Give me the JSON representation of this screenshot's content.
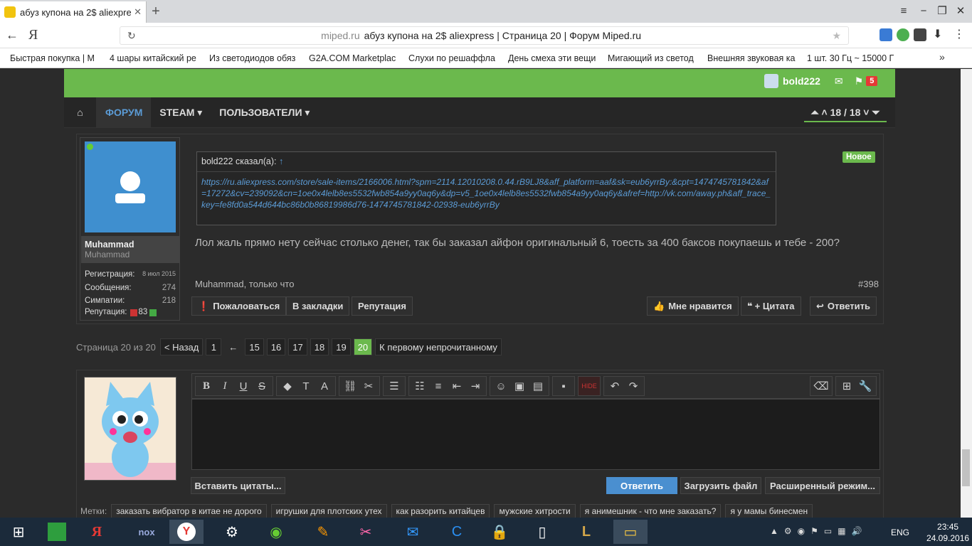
{
  "browser": {
    "tab_title": "абуз купона на 2$ aliexpress",
    "tab_close": "✕",
    "new_tab": "+",
    "yandex_logo": "Я",
    "url_domain": "miped.ru",
    "page_title": "абуз купона на 2$ aliexpress | Страница 20 | Форум Miped.ru",
    "bookmarks": [
      "Быстрая покупка | M",
      "4 шары китайский ре",
      "Из светодиодов обяз",
      "G2A.COM Marketplac",
      "Слухи по решаффла",
      "День смеха эти вещи",
      "Мигающий из светод",
      "Внешняя звуковая ка",
      "1 шт. 30 Гц ~ 15000 Г"
    ],
    "bookmarks_more": "»"
  },
  "site": {
    "username": "bold222",
    "notif_count": "5",
    "nav": {
      "forum": "ФОРУМ",
      "steam": "STEAM ▾",
      "users": "ПОЛЬЗОВАТЕЛИ ▾"
    },
    "page_jump": "18 / 18"
  },
  "post": {
    "author": "Muhammad",
    "author_title": "Muhammad",
    "stats": [
      {
        "label": "Регистрация:",
        "value": "8 июл 2015"
      },
      {
        "label": "Сообщения:",
        "value": "274"
      },
      {
        "label": "Симпатии:",
        "value": "218"
      }
    ],
    "rep_label": "Репутация:",
    "rep_value": "83",
    "quote_author": "bold222 сказал(а):",
    "quote_arrow": "↑",
    "quote_link": "https://ru.aliexpress.com/store/sale-items/2166006.html?spm=2114.12010208.0.44.rB9LJ8&aff_platform=aaf&sk=eub6yrrBy:&cpt=1474745781842&af=17272&cv=239092&cn=1oe0x4lelb8es5532fwb854a9yy0aq6y&dp=v5_1oe0x4lelb8es5532fwb854a9yy0aq6y&afref=http://vk.com/away.ph&aff_trace_key=fe8fd0a544d644bc86b0b86819986d76-1474745781842-02938-eub6yrrBy",
    "new_badge": "Новое",
    "message": "Лол жаль прямо нету сейчас столько денег, так бы заказал айфон оригинальный 6, тоесть за 400 баксов покупаешь и тебе - 200?",
    "meta": "Muhammad, только что",
    "number": "#398",
    "buttons": {
      "report": "Пожаловаться",
      "bookmark": "В закладки",
      "rep": "Репутация",
      "like": "Мне нравится",
      "quote": "+ Цитата",
      "reply": "Ответить"
    }
  },
  "pagination": {
    "label": "Страница 20 из 20",
    "prev": "< Назад",
    "first": "1",
    "ellipsis": "←",
    "pages": [
      "15",
      "16",
      "17",
      "18",
      "19"
    ],
    "current": "20",
    "unread": "К первому непрочитанному"
  },
  "reply": {
    "insert_quotes": "Вставить цитаты...",
    "submit": "Ответить",
    "upload": "Загрузить файл",
    "advanced": "Расширенный режим...",
    "hide_label": "HIDE"
  },
  "tags": {
    "label": "Метки:",
    "items": [
      "заказать вибратор в китае не дорого",
      "игрушки для плотских утех",
      "как разорить китайцев",
      "мужские хитрости",
      "я анимешник - что мне заказать?",
      "я у мамы бинесмен"
    ]
  },
  "taskbar": {
    "lang": "ENG",
    "time": "23:45",
    "date": "24.09.2016"
  },
  "colors": {
    "accent_green": "#6bb94d",
    "link_blue": "#5b9bd5",
    "bg_dark": "#2b2b2b"
  }
}
